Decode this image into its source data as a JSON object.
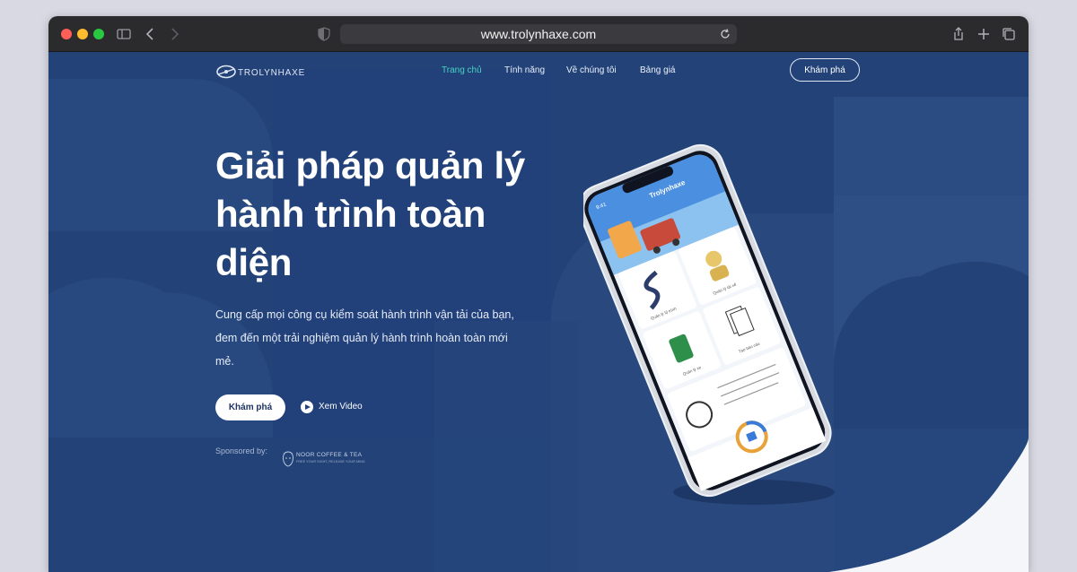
{
  "browser": {
    "url": "www.trolynhaxe.com"
  },
  "nav": {
    "logo_text": "TROLYNHAXE",
    "links": [
      "Trang chủ",
      "Tính năng",
      "Về chúng tôi",
      "Bảng giá"
    ],
    "active_index": 0,
    "cta_label": "Khám phá"
  },
  "hero": {
    "headline_lines": [
      "Giải pháp quản lý",
      "hành trình toàn",
      "diện"
    ],
    "description_lines": [
      "Cung cấp mọi công cụ kiểm soát hành trình vận tải của bạn,",
      "đem đến một trải nghiệm quản lý hành trình hoàn toàn mới",
      "mẻ."
    ],
    "primary_cta": "Khám phá",
    "video_cta": "Xem Video",
    "sponsored_label": "Sponsored by:",
    "sponsor_name": "NOOR COFFEE & TEA",
    "sponsor_tagline": "FREE YOUR SIGHT, RELEASE YOUR MIND"
  },
  "phone_app": {
    "status_time": "9:41",
    "app_title": "Trolynhaxe",
    "tiles": [
      "Quản lý lộ trình",
      "Quản lý tài xế",
      "Quản lý xe",
      "Tạo báo cáo"
    ]
  },
  "colors": {
    "page_bg": "#234378",
    "accent_active": "#46d2c1",
    "titlebar": "#2b2b2e"
  }
}
